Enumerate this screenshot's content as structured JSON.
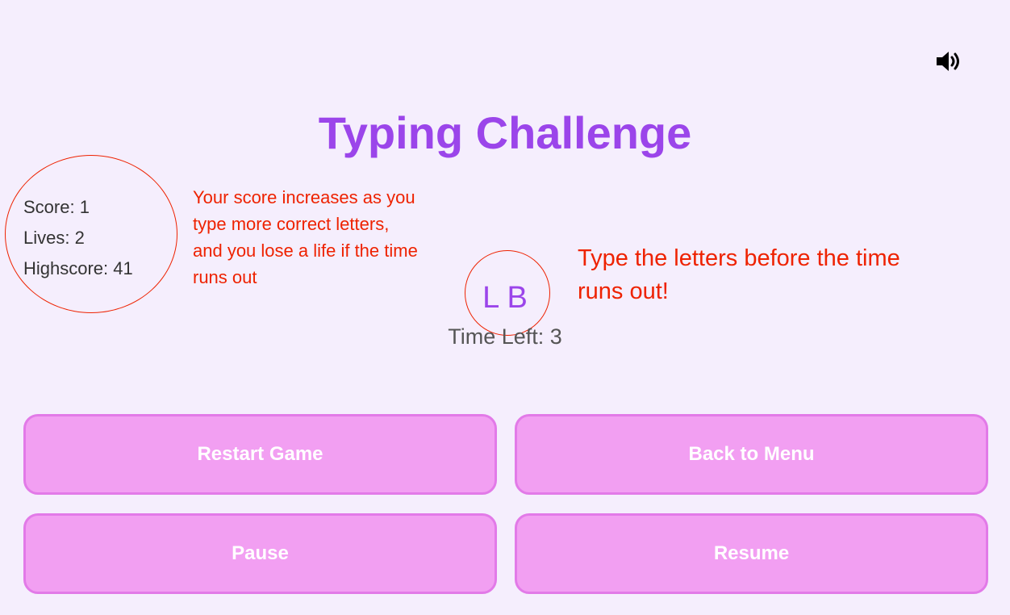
{
  "header": {
    "sound_icon": "speaker-volume-icon"
  },
  "game": {
    "title": "Typing Challenge",
    "score_text": "Score: 1",
    "lives_text": "Lives: 2",
    "highscore_text": "Highscore: 41",
    "letters": "L B",
    "time_left_text": "Time Left: 3"
  },
  "annotations": {
    "stats_note": "Your score increases as you type more correct letters, and you lose a life if the time runs out",
    "letters_note": "Type the letters before the time runs out!"
  },
  "buttons": {
    "restart": "Restart Game",
    "menu": "Back to Menu",
    "pause": "Pause",
    "resume": "Resume"
  },
  "colors": {
    "background": "#f5eefd",
    "title": "#9b45ea",
    "button_fill": "#f29ff2",
    "button_border": "#e27ae8",
    "annotation": "#ee2200"
  }
}
